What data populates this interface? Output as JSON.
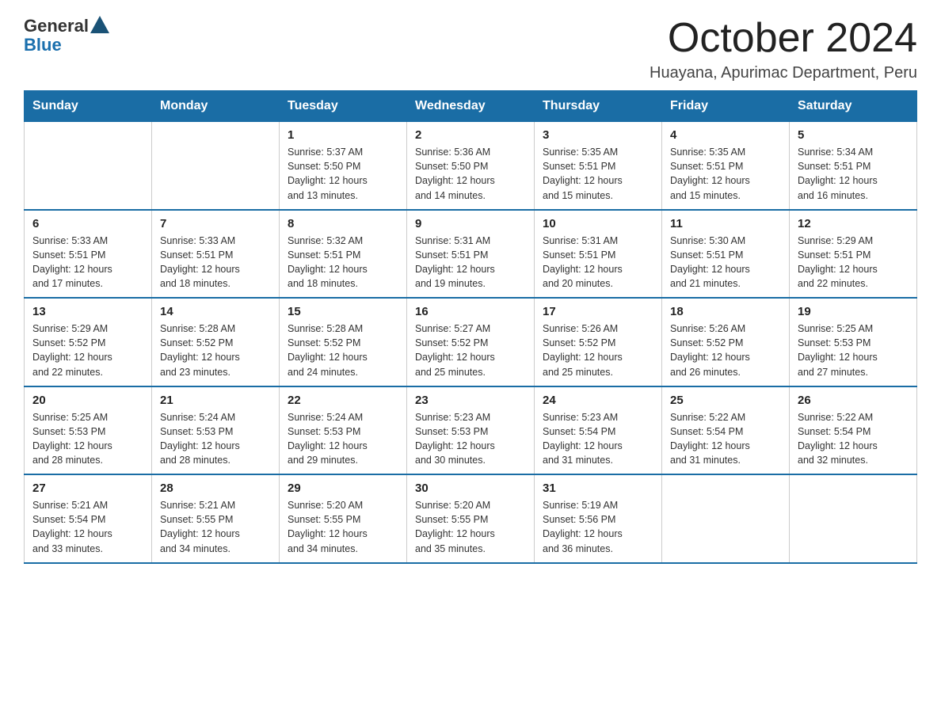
{
  "header": {
    "logo_general": "General",
    "logo_blue": "Blue",
    "title": "October 2024",
    "subtitle": "Huayana, Apurimac Department, Peru"
  },
  "weekdays": [
    "Sunday",
    "Monday",
    "Tuesday",
    "Wednesday",
    "Thursday",
    "Friday",
    "Saturday"
  ],
  "weeks": [
    [
      {
        "day": "",
        "info": ""
      },
      {
        "day": "",
        "info": ""
      },
      {
        "day": "1",
        "info": "Sunrise: 5:37 AM\nSunset: 5:50 PM\nDaylight: 12 hours\nand 13 minutes."
      },
      {
        "day": "2",
        "info": "Sunrise: 5:36 AM\nSunset: 5:50 PM\nDaylight: 12 hours\nand 14 minutes."
      },
      {
        "day": "3",
        "info": "Sunrise: 5:35 AM\nSunset: 5:51 PM\nDaylight: 12 hours\nand 15 minutes."
      },
      {
        "day": "4",
        "info": "Sunrise: 5:35 AM\nSunset: 5:51 PM\nDaylight: 12 hours\nand 15 minutes."
      },
      {
        "day": "5",
        "info": "Sunrise: 5:34 AM\nSunset: 5:51 PM\nDaylight: 12 hours\nand 16 minutes."
      }
    ],
    [
      {
        "day": "6",
        "info": "Sunrise: 5:33 AM\nSunset: 5:51 PM\nDaylight: 12 hours\nand 17 minutes."
      },
      {
        "day": "7",
        "info": "Sunrise: 5:33 AM\nSunset: 5:51 PM\nDaylight: 12 hours\nand 18 minutes."
      },
      {
        "day": "8",
        "info": "Sunrise: 5:32 AM\nSunset: 5:51 PM\nDaylight: 12 hours\nand 18 minutes."
      },
      {
        "day": "9",
        "info": "Sunrise: 5:31 AM\nSunset: 5:51 PM\nDaylight: 12 hours\nand 19 minutes."
      },
      {
        "day": "10",
        "info": "Sunrise: 5:31 AM\nSunset: 5:51 PM\nDaylight: 12 hours\nand 20 minutes."
      },
      {
        "day": "11",
        "info": "Sunrise: 5:30 AM\nSunset: 5:51 PM\nDaylight: 12 hours\nand 21 minutes."
      },
      {
        "day": "12",
        "info": "Sunrise: 5:29 AM\nSunset: 5:51 PM\nDaylight: 12 hours\nand 22 minutes."
      }
    ],
    [
      {
        "day": "13",
        "info": "Sunrise: 5:29 AM\nSunset: 5:52 PM\nDaylight: 12 hours\nand 22 minutes."
      },
      {
        "day": "14",
        "info": "Sunrise: 5:28 AM\nSunset: 5:52 PM\nDaylight: 12 hours\nand 23 minutes."
      },
      {
        "day": "15",
        "info": "Sunrise: 5:28 AM\nSunset: 5:52 PM\nDaylight: 12 hours\nand 24 minutes."
      },
      {
        "day": "16",
        "info": "Sunrise: 5:27 AM\nSunset: 5:52 PM\nDaylight: 12 hours\nand 25 minutes."
      },
      {
        "day": "17",
        "info": "Sunrise: 5:26 AM\nSunset: 5:52 PM\nDaylight: 12 hours\nand 25 minutes."
      },
      {
        "day": "18",
        "info": "Sunrise: 5:26 AM\nSunset: 5:52 PM\nDaylight: 12 hours\nand 26 minutes."
      },
      {
        "day": "19",
        "info": "Sunrise: 5:25 AM\nSunset: 5:53 PM\nDaylight: 12 hours\nand 27 minutes."
      }
    ],
    [
      {
        "day": "20",
        "info": "Sunrise: 5:25 AM\nSunset: 5:53 PM\nDaylight: 12 hours\nand 28 minutes."
      },
      {
        "day": "21",
        "info": "Sunrise: 5:24 AM\nSunset: 5:53 PM\nDaylight: 12 hours\nand 28 minutes."
      },
      {
        "day": "22",
        "info": "Sunrise: 5:24 AM\nSunset: 5:53 PM\nDaylight: 12 hours\nand 29 minutes."
      },
      {
        "day": "23",
        "info": "Sunrise: 5:23 AM\nSunset: 5:53 PM\nDaylight: 12 hours\nand 30 minutes."
      },
      {
        "day": "24",
        "info": "Sunrise: 5:23 AM\nSunset: 5:54 PM\nDaylight: 12 hours\nand 31 minutes."
      },
      {
        "day": "25",
        "info": "Sunrise: 5:22 AM\nSunset: 5:54 PM\nDaylight: 12 hours\nand 31 minutes."
      },
      {
        "day": "26",
        "info": "Sunrise: 5:22 AM\nSunset: 5:54 PM\nDaylight: 12 hours\nand 32 minutes."
      }
    ],
    [
      {
        "day": "27",
        "info": "Sunrise: 5:21 AM\nSunset: 5:54 PM\nDaylight: 12 hours\nand 33 minutes."
      },
      {
        "day": "28",
        "info": "Sunrise: 5:21 AM\nSunset: 5:55 PM\nDaylight: 12 hours\nand 34 minutes."
      },
      {
        "day": "29",
        "info": "Sunrise: 5:20 AM\nSunset: 5:55 PM\nDaylight: 12 hours\nand 34 minutes."
      },
      {
        "day": "30",
        "info": "Sunrise: 5:20 AM\nSunset: 5:55 PM\nDaylight: 12 hours\nand 35 minutes."
      },
      {
        "day": "31",
        "info": "Sunrise: 5:19 AM\nSunset: 5:56 PM\nDaylight: 12 hours\nand 36 minutes."
      },
      {
        "day": "",
        "info": ""
      },
      {
        "day": "",
        "info": ""
      }
    ]
  ]
}
